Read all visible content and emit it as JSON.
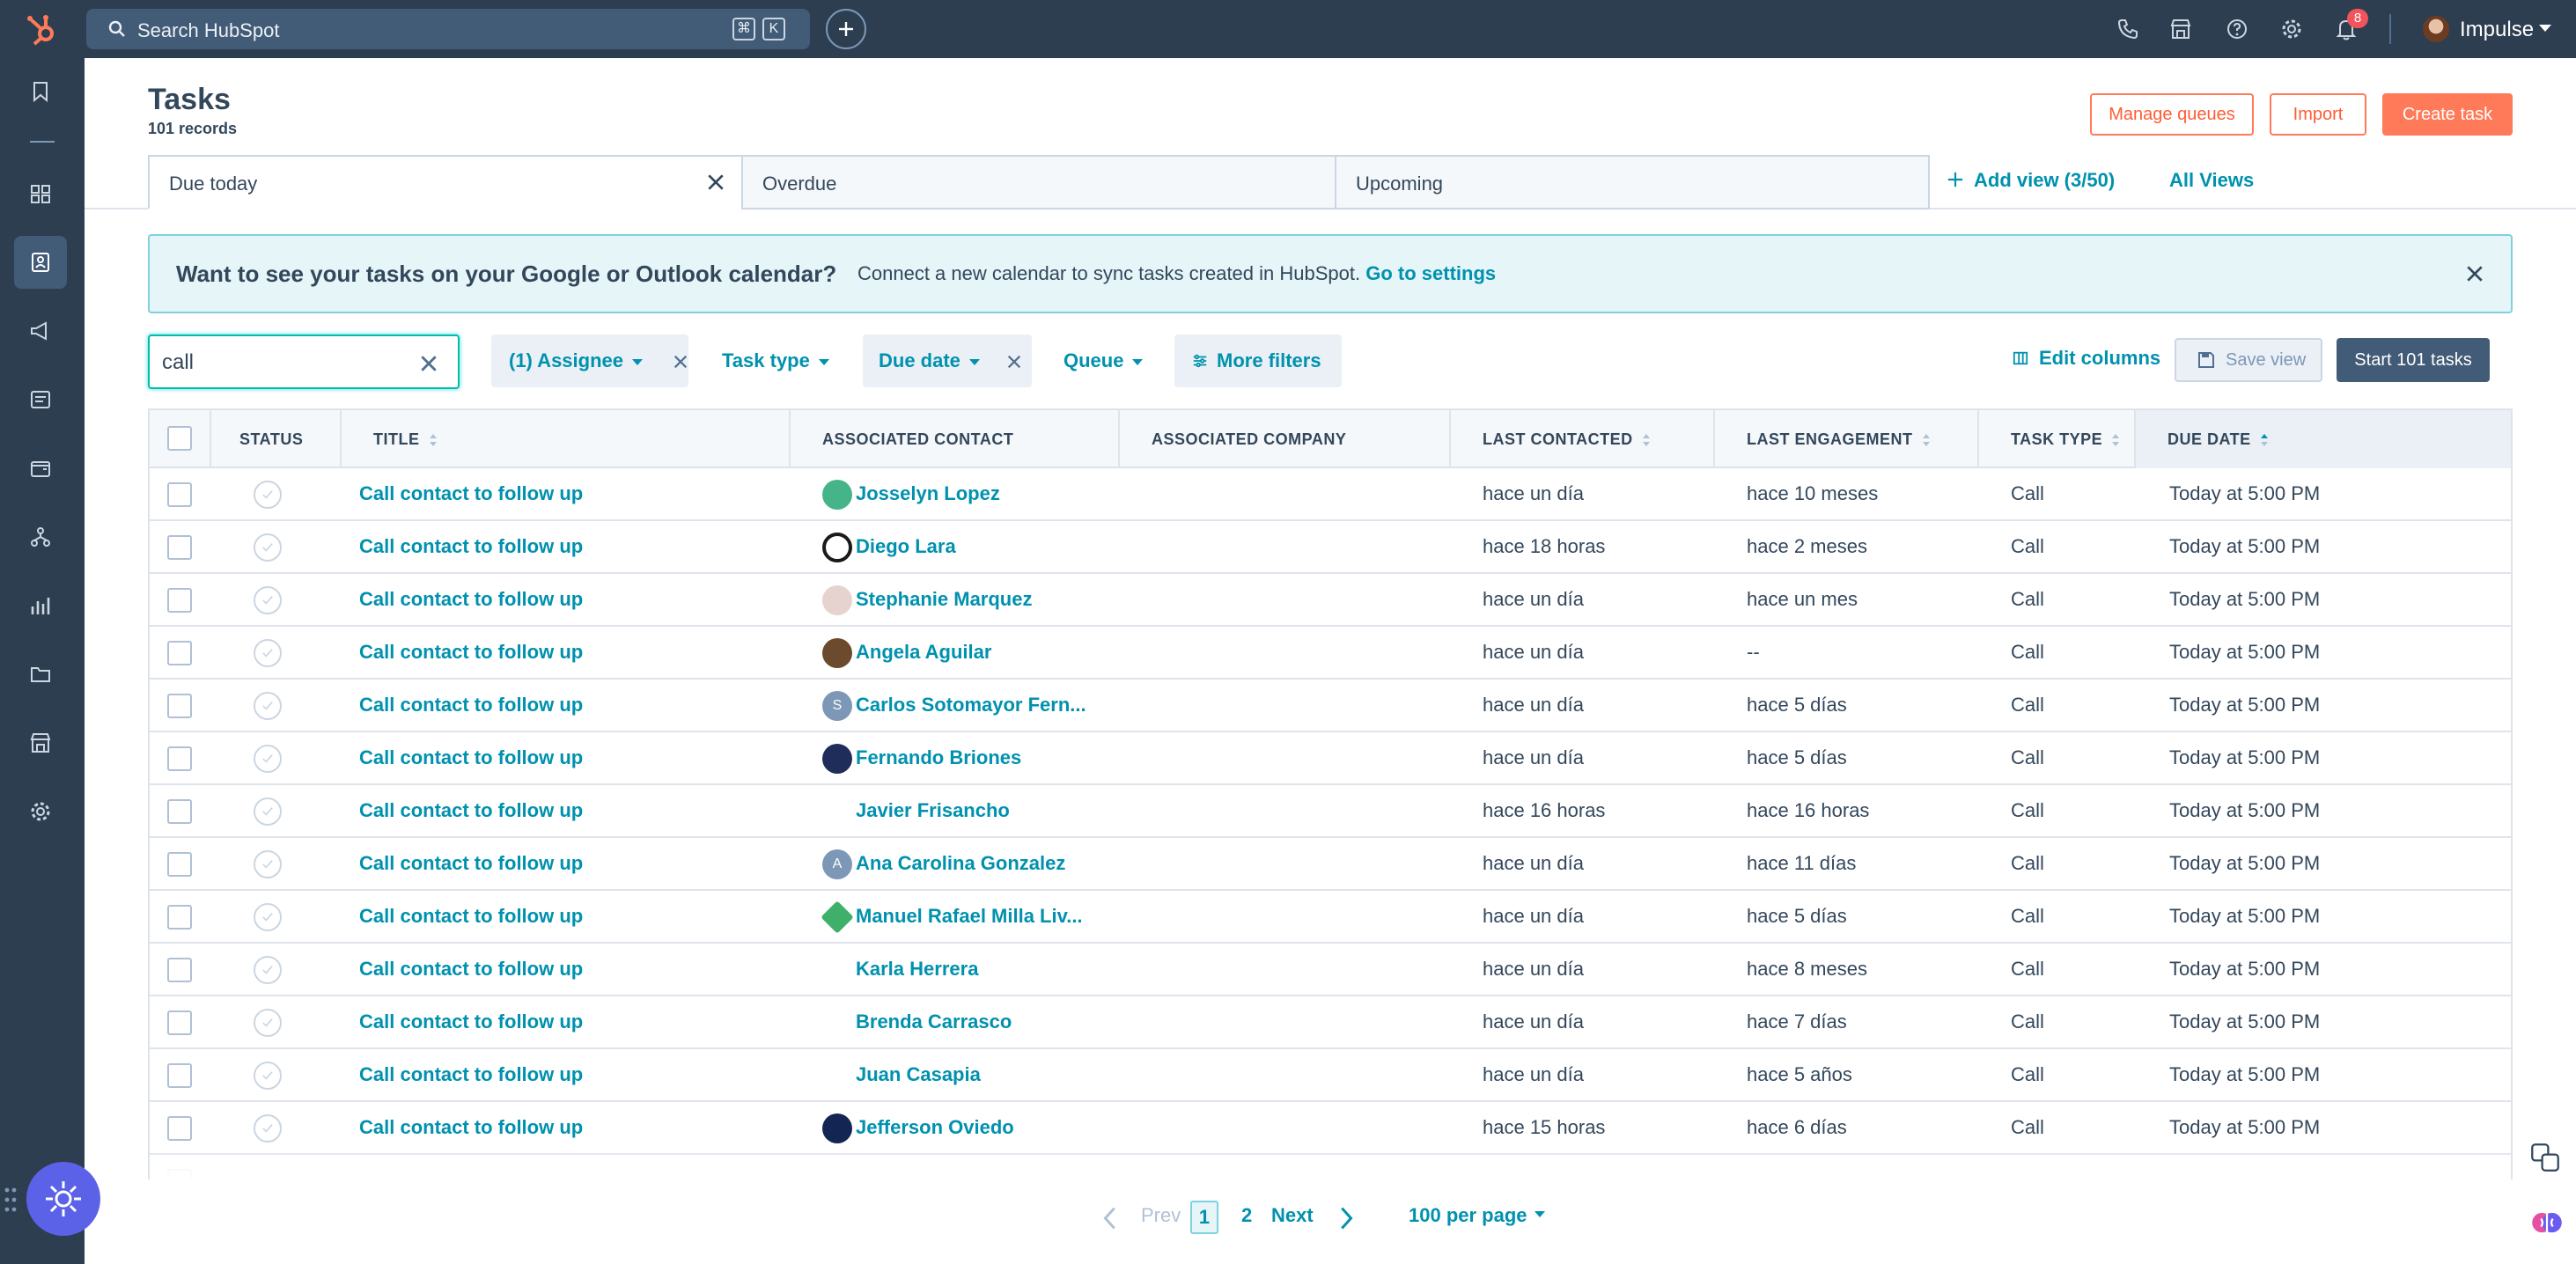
{
  "topbar": {
    "search_placeholder": "Search HubSpot",
    "shortcut_keys": [
      "⌘",
      "K"
    ],
    "notifications_count": "8",
    "account_name": "Impulse"
  },
  "page": {
    "title": "Tasks",
    "record_count": "101 records"
  },
  "header_actions": {
    "manage_queues": "Manage queues",
    "import": "Import",
    "create_task": "Create task"
  },
  "views": {
    "tabs": [
      {
        "label": "Due today",
        "active": true
      },
      {
        "label": "Overdue",
        "active": false
      },
      {
        "label": "Upcoming",
        "active": false
      }
    ],
    "add_view": "Add view (3/50)",
    "all_views": "All Views"
  },
  "banner": {
    "heading": "Want to see your tasks on your Google or Outlook calendar?",
    "message": "Connect a new calendar to sync tasks created in HubSpot.",
    "link": "Go to settings"
  },
  "filters": {
    "search_value": "call",
    "assignee": "(1) Assignee",
    "task_type": "Task type",
    "due_date": "Due date",
    "queue": "Queue",
    "more_filters": "More filters",
    "edit_columns": "Edit columns",
    "save_view": "Save view",
    "start_tasks": "Start 101 tasks"
  },
  "table": {
    "columns": [
      "STATUS",
      "TITLE",
      "ASSOCIATED CONTACT",
      "ASSOCIATED COMPANY",
      "LAST CONTACTED",
      "LAST ENGAGEMENT",
      "TASK TYPE",
      "DUE DATE"
    ],
    "rows": [
      {
        "title": "Call contact to follow up",
        "contact": "Josselyn Lopez",
        "company": "",
        "last_contacted": "hace un día",
        "last_engagement": "hace 10 meses",
        "task_type": "Call",
        "due_date": "Today at 5:00 PM"
      },
      {
        "title": "Call contact to follow up",
        "contact": "Diego Lara",
        "company": "",
        "last_contacted": "hace 18 horas",
        "last_engagement": "hace 2 meses",
        "task_type": "Call",
        "due_date": "Today at 5:00 PM"
      },
      {
        "title": "Call contact to follow up",
        "contact": "Stephanie Marquez",
        "company": "",
        "last_contacted": "hace un día",
        "last_engagement": "hace un mes",
        "task_type": "Call",
        "due_date": "Today at 5:00 PM"
      },
      {
        "title": "Call contact to follow up",
        "contact": "Angela Aguilar",
        "company": "",
        "last_contacted": "hace un día",
        "last_engagement": "--",
        "task_type": "Call",
        "due_date": "Today at 5:00 PM"
      },
      {
        "title": "Call contact to follow up",
        "contact": "Carlos Sotomayor Fern...",
        "company": "",
        "last_contacted": "hace un día",
        "last_engagement": "hace 5 días",
        "task_type": "Call",
        "due_date": "Today at 5:00 PM",
        "avatar_letter": "S"
      },
      {
        "title": "Call contact to follow up",
        "contact": "Fernando Briones",
        "company": "",
        "last_contacted": "hace un día",
        "last_engagement": "hace 5 días",
        "task_type": "Call",
        "due_date": "Today at 5:00 PM"
      },
      {
        "title": "Call contact to follow up",
        "contact": "Javier Frisancho",
        "company": "",
        "last_contacted": "hace 16 horas",
        "last_engagement": "hace 16 horas",
        "task_type": "Call",
        "due_date": "Today at 5:00 PM"
      },
      {
        "title": "Call contact to follow up",
        "contact": "Ana Carolina Gonzalez",
        "company": "",
        "last_contacted": "hace un día",
        "last_engagement": "hace 11 días",
        "task_type": "Call",
        "due_date": "Today at 5:00 PM",
        "avatar_letter": "A"
      },
      {
        "title": "Call contact to follow up",
        "contact": "Manuel Rafael Milla Liv...",
        "company": "",
        "last_contacted": "hace un día",
        "last_engagement": "hace 5 días",
        "task_type": "Call",
        "due_date": "Today at 5:00 PM"
      },
      {
        "title": "Call contact to follow up",
        "contact": "Karla Herrera",
        "company": "",
        "last_contacted": "hace un día",
        "last_engagement": "hace 8 meses",
        "task_type": "Call",
        "due_date": "Today at 5:00 PM"
      },
      {
        "title": "Call contact to follow up",
        "contact": "Brenda Carrasco",
        "company": "",
        "last_contacted": "hace un día",
        "last_engagement": "hace 7 días",
        "task_type": "Call",
        "due_date": "Today at 5:00 PM"
      },
      {
        "title": "Call contact to follow up",
        "contact": "Juan Casapia",
        "company": "",
        "last_contacted": "hace un día",
        "last_engagement": "hace 5 años",
        "task_type": "Call",
        "due_date": "Today at 5:00 PM"
      },
      {
        "title": "Call contact to follow up",
        "contact": "Jefferson Oviedo",
        "company": "",
        "last_contacted": "hace 15 horas",
        "last_engagement": "hace 6 días",
        "task_type": "Call",
        "due_date": "Today at 5:00 PM"
      }
    ]
  },
  "pagination": {
    "prev": "Prev",
    "current_page": "1",
    "next_page": "2",
    "next": "Next",
    "per_page": "100 per page"
  },
  "colors": {
    "topbar": "#2d3e50",
    "link": "#0091ae",
    "accent": "#ff7a59",
    "text": "#33475b",
    "assistant": "#5c62e8"
  },
  "icons": {
    "nav": [
      "bookmark-icon",
      "apps-grid-icon",
      "contacts-icon",
      "marketing-megaphone-icon",
      "content-icon",
      "commerce-icon",
      "automation-icon",
      "reporting-icon",
      "library-folder-icon",
      "marketplace-icon",
      "settings-icon"
    ]
  }
}
